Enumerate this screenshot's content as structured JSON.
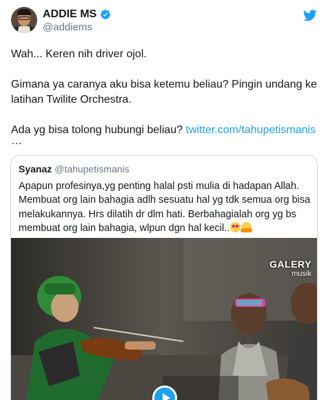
{
  "author": {
    "display_name": "ADDIE MS",
    "handle": "@addiems"
  },
  "tweet": {
    "line1": "Wah... Keren nih driver ojol.",
    "line2": "Gimana ya caranya aku bisa ketemu beliau? Pingin undang ke latihan Twilite Orchestra.",
    "line3_text": "Ada yg bisa tolong hubungi beliau? ",
    "line3_link": "twitter.com/tahupetismanis",
    "ellipsis": "…"
  },
  "quoted": {
    "name": "Syanaz",
    "handle": "@tahupetismanis",
    "text": "Apapun profesinya,yg penting halal psti mulia di hadapan Allah. Membuat org lain bahagia adlh sesuatu hal yg tdk semua org bisa melakukannya. Hrs dilatih dr dlm hati. Berbahagialah org yg bs membuat org lain bahagia, wlpun dgn hal kecil.."
  },
  "media": {
    "watermark_line1": "GALERY",
    "watermark_line2": "musik"
  },
  "icons": {
    "verified": "verified-badge-icon",
    "twitter": "twitter-bird-icon",
    "play": "play-icon",
    "emoji1": "heart-eyes-emoji",
    "emoji2": "hugging-face-emoji"
  },
  "colors": {
    "link": "#1da1f2",
    "text": "#14171a",
    "secondary": "#657786",
    "border": "#ccd6dd"
  }
}
